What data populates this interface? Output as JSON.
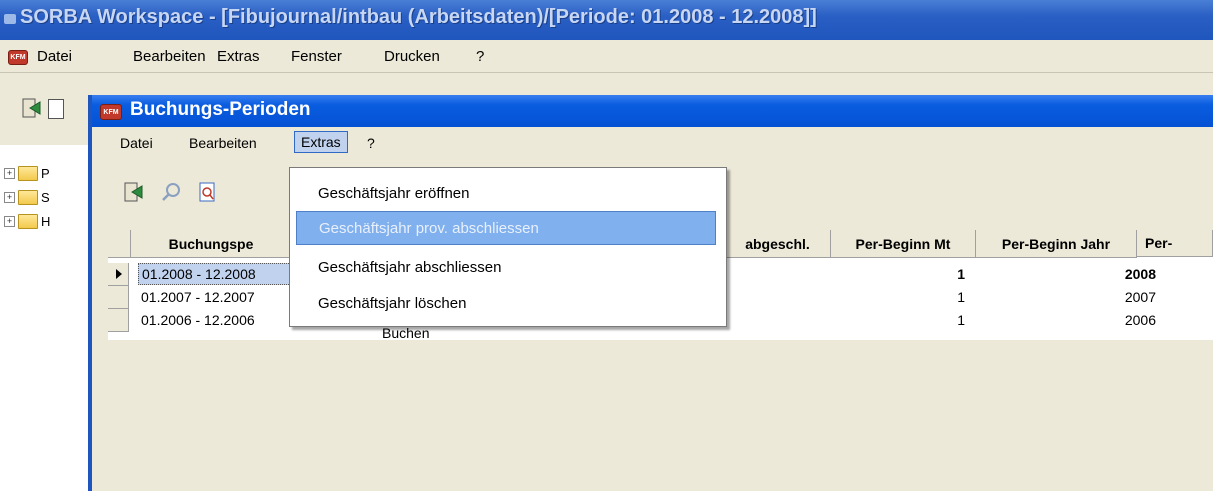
{
  "outer_window": {
    "title": "SORBA Workspace - [Fibujournal/intbau (Arbeitsdaten)/[Periode: 01.2008 - 12.2008]]",
    "menu": [
      "Datei",
      "Bearbeiten",
      "Extras",
      "Fenster",
      "Drucken",
      "?"
    ],
    "tree_items": [
      "P",
      "S",
      "H"
    ]
  },
  "inner_window": {
    "title": "Buchungs-Perioden",
    "menu": [
      "Datei",
      "Bearbeiten",
      "Extras",
      "?"
    ],
    "app_icon_label": "KFM"
  },
  "extras_menu": {
    "items": [
      {
        "label": "Geschäftsjahr eröffnen",
        "highlighted": false
      },
      {
        "label": "Geschäftsjahr prov. abschliessen",
        "highlighted": true
      },
      {
        "label": "Geschäftsjahr abschliessen",
        "highlighted": false
      },
      {
        "label": "Geschäftsjahr löschen",
        "highlighted": false
      }
    ]
  },
  "table": {
    "columns": [
      "Buchungspe",
      "abgeschl.",
      "Per-Beginn Mt",
      "Per-Beginn Jahr",
      "Per-"
    ],
    "rows": [
      {
        "period": "01.2008 - 12.2008",
        "status": "",
        "beginn_mt": "1",
        "beginn_jahr": "2008",
        "selected": true
      },
      {
        "period": "01.2007 - 12.2007",
        "status": "",
        "beginn_mt": "1",
        "beginn_jahr": "2007",
        "selected": false
      },
      {
        "period": "01.2006 - 12.2006",
        "status": "Buchen",
        "beginn_mt": "1",
        "beginn_jahr": "2006",
        "selected": false
      }
    ]
  },
  "colors": {
    "title_blue": "#0551d4",
    "highlight": "#80b0ee",
    "row_selected": "#c1d2ee"
  }
}
